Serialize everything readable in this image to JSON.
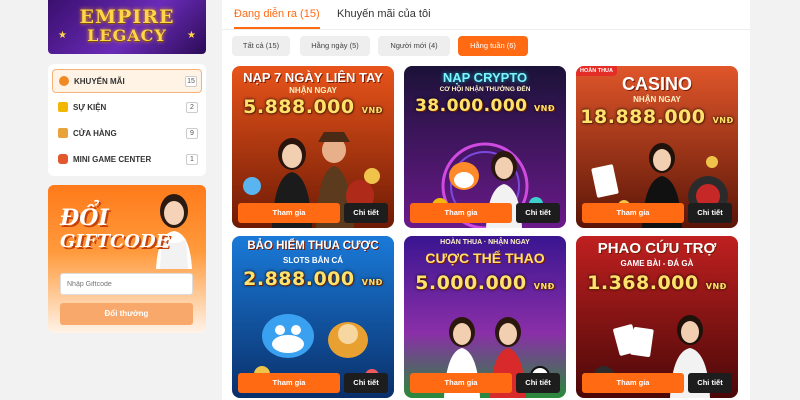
{
  "logo": {
    "line1": "EMPIRE",
    "line2": "LEGACY"
  },
  "menu": [
    {
      "label": "KHUYẾN MÃI",
      "count": "15",
      "icon": "gift-bag-icon",
      "active": true
    },
    {
      "label": "SỰ KIỆN",
      "count": "2",
      "icon": "trophy-icon",
      "active": false
    },
    {
      "label": "CỬA HÀNG",
      "count": "9",
      "icon": "shop-icon",
      "active": false
    },
    {
      "label": "MINI GAME CENTER",
      "count": "1",
      "icon": "gamepad-icon",
      "active": false
    }
  ],
  "giftcode": {
    "title1": "ĐỔI",
    "title2": "GIFTCODE",
    "placeholder": "Nhập Giftcode",
    "button": "Đổi thưởng"
  },
  "tabs": [
    {
      "label": "Đang diễn ra (15)",
      "active": true
    },
    {
      "label": "Khuyến mãi của tôi",
      "active": false
    }
  ],
  "filters": [
    {
      "label": "Tất cả (15)",
      "active": false
    },
    {
      "label": "Hằng ngày (5)",
      "active": false
    },
    {
      "label": "Người mới (4)",
      "active": false
    },
    {
      "label": "Hằng tuần (6)",
      "active": true
    }
  ],
  "cards": [
    {
      "title": "NẠP 7 NGÀY LIÊN TAY",
      "subtitle": "NHẬN NGAY",
      "amount": "5.888.000",
      "unit": "VNĐ",
      "tag": "",
      "join": "Tham gia",
      "detail": "Chi tiết"
    },
    {
      "title": "NẠP CRYPTO",
      "subtitle": "CƠ HỘI NHẬN THƯỞNG ĐẾN",
      "amount": "38.000.000",
      "unit": "VNĐ",
      "tag": "",
      "join": "Tham gia",
      "detail": "Chi tiết"
    },
    {
      "title": "CASINO",
      "subtitle": "NHẬN NGAY",
      "amount": "18.888.000",
      "unit": "VNĐ",
      "tag": "HOÀN THUA",
      "join": "Tham gia",
      "detail": "Chi tiết"
    },
    {
      "title": "BẢO HIỂM THUA CƯỢC",
      "subtitle": "SLOTS BẮN CÁ",
      "amount": "2.888.000",
      "unit": "VNĐ",
      "tag": "",
      "join": "Tham gia",
      "detail": "Chi tiết"
    },
    {
      "title": "CƯỢC THỂ THAO",
      "subtitle": "HOÀN THUA · NHẬN NGAY",
      "amount": "5.000.000",
      "unit": "VNĐ",
      "tag": "",
      "join": "Tham gia",
      "detail": "Chi tiết"
    },
    {
      "title": "PHAO CỨU TRỢ",
      "subtitle": "GAME BÀI - ĐÁ GÀ",
      "amount": "1.368.000",
      "unit": "VNĐ",
      "tag": "",
      "join": "Tham gia",
      "detail": "Chi tiết"
    }
  ],
  "colors": {
    "accent": "#ff6a13",
    "detail_button": "#1d1d1d",
    "card_bg": [
      "#b8320e",
      "#3a1078",
      "#c2431a",
      "#0f5fb8",
      "#7a1f8f",
      "#8a1414"
    ]
  }
}
